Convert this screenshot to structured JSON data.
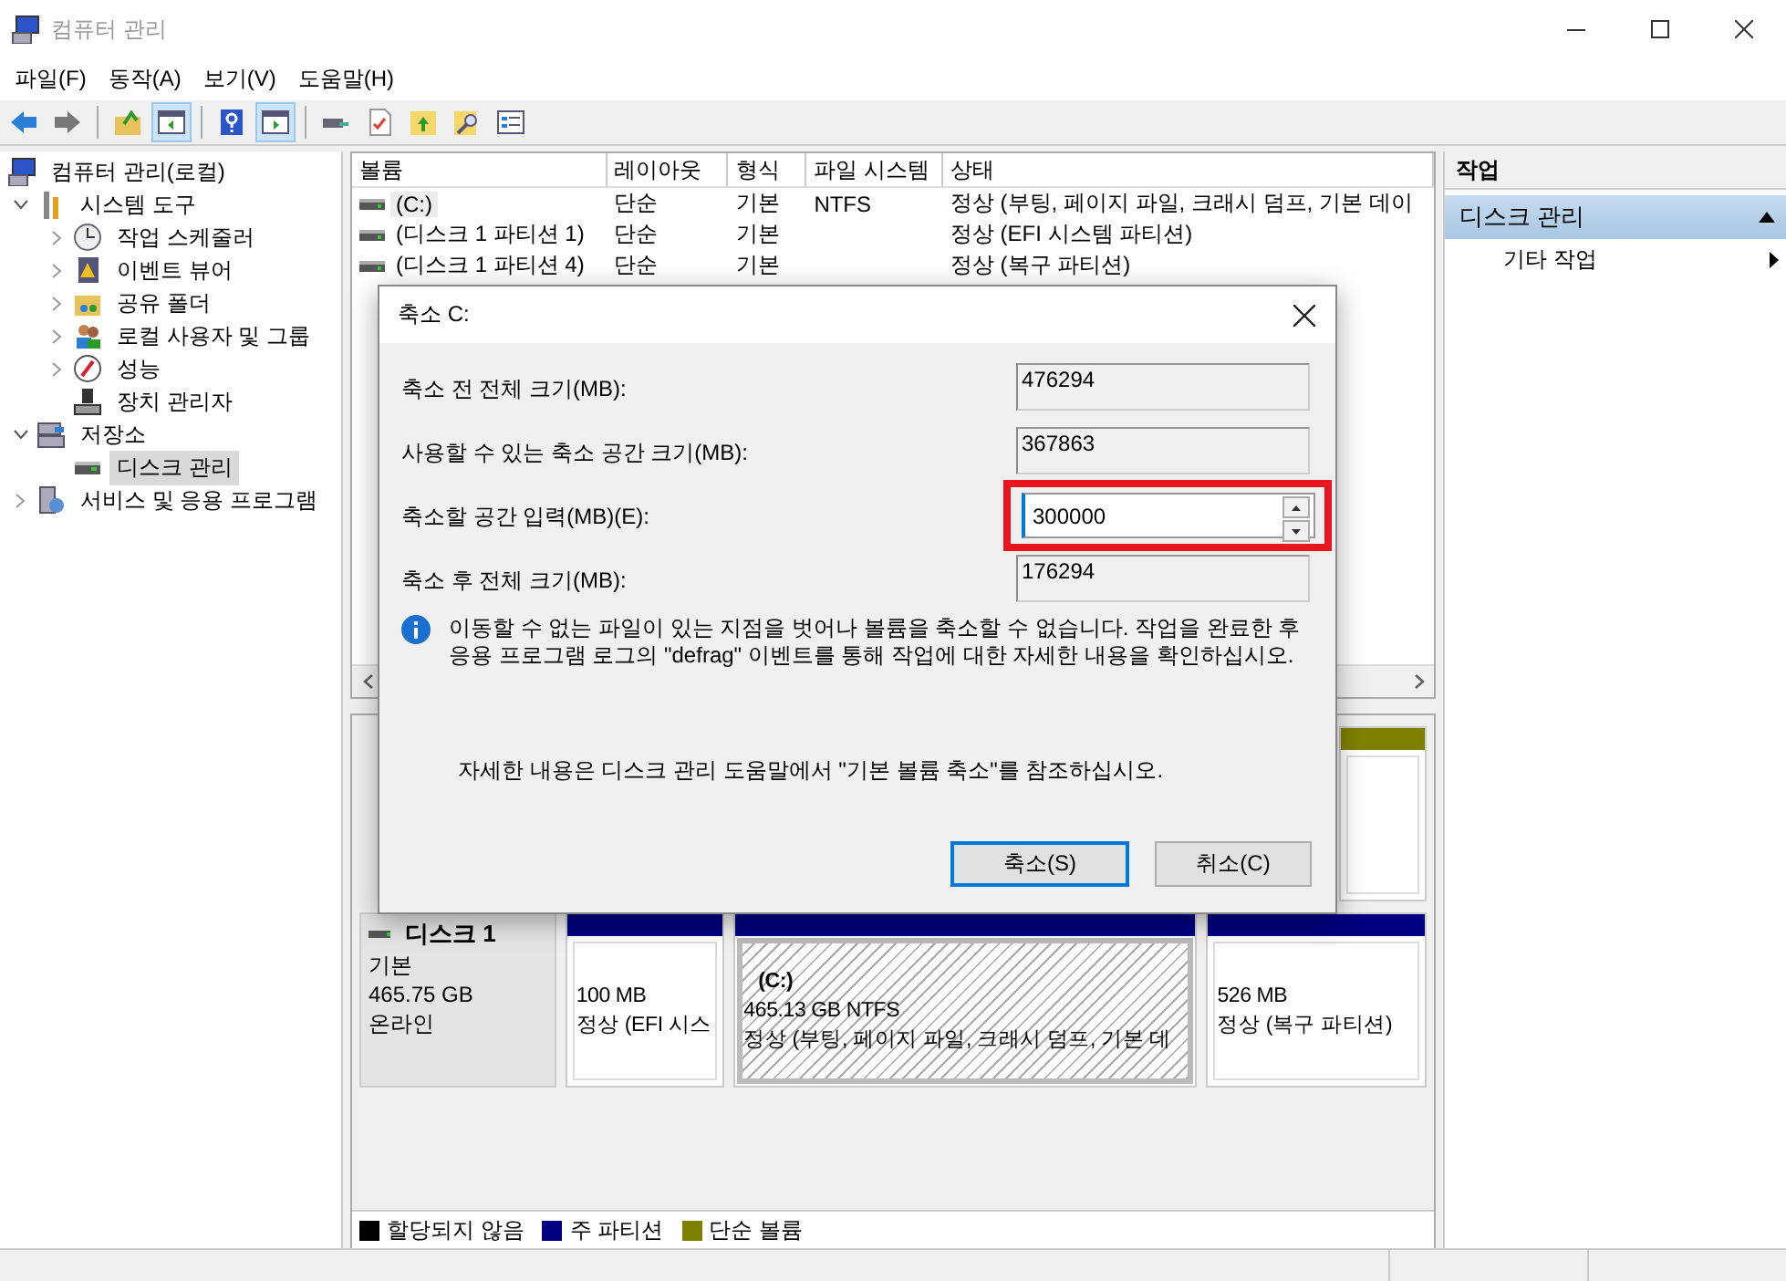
{
  "window": {
    "title": "컴퓨터 관리"
  },
  "menu": [
    "파일(F)",
    "동작(A)",
    "보기(V)",
    "도움말(H)"
  ],
  "toolbar": [
    {
      "kind": "button",
      "pressed": false
    },
    {
      "kind": "button",
      "pressed": false
    },
    {
      "kind": "separator"
    },
    {
      "kind": "button",
      "pressed": false
    },
    {
      "kind": "button",
      "pressed": true
    },
    {
      "kind": "separator"
    },
    {
      "kind": "button",
      "pressed": false
    },
    {
      "kind": "button",
      "pressed": true
    },
    {
      "kind": "separator"
    },
    {
      "kind": "button",
      "pressed": false
    },
    {
      "kind": "button",
      "pressed": false
    },
    {
      "kind": "button",
      "pressed": false
    },
    {
      "kind": "button",
      "pressed": false
    },
    {
      "kind": "button",
      "pressed": false
    }
  ],
  "tree": [
    {
      "label": "컴퓨터 관리(로컬)",
      "kind": "root",
      "selected": false,
      "children": [
        {
          "label": "시스템 도구",
          "kind": "node",
          "expanded": true,
          "selected": false,
          "children": [
            {
              "label": "작업 스케줄러",
              "kind": "node",
              "expanded": false,
              "selected": false
            },
            {
              "label": "이벤트 뷰어",
              "kind": "node",
              "expanded": false,
              "selected": false
            },
            {
              "label": "공유 폴더",
              "kind": "node",
              "expanded": false,
              "selected": false
            },
            {
              "label": "로컬 사용자 및 그룹",
              "kind": "node",
              "expanded": false,
              "selected": false
            },
            {
              "label": "성능",
              "kind": "node",
              "expanded": false,
              "selected": false
            },
            {
              "label": "장치 관리자",
              "kind": "leaf",
              "selected": false
            }
          ]
        },
        {
          "label": "저장소",
          "kind": "node",
          "expanded": true,
          "selected": false,
          "children": [
            {
              "label": "디스크 관리",
              "kind": "leaf",
              "selected": true
            }
          ]
        },
        {
          "label": "서비스 및 응용 프로그램",
          "kind": "node",
          "expanded": false,
          "selected": false
        }
      ]
    }
  ],
  "volume_list": {
    "columns": [
      "볼륨",
      "레이아웃",
      "형식",
      "파일 시스템",
      "상태"
    ],
    "rows": [
      {
        "volume": "(C:)",
        "layout": "단순",
        "type": "기본",
        "file_system": "NTFS",
        "status": "정상 (부팅, 페이지 파일, 크래시 덤프, 기본 데이",
        "selected": true
      },
      {
        "volume": "(디스크 1 파티션 1)",
        "layout": "단순",
        "type": "기본",
        "status": "정상 (EFI 시스템 파티션)",
        "selected": false
      },
      {
        "volume": "(디스크 1 파티션 4)",
        "layout": "단순",
        "type": "기본",
        "status": "정상 (복구 파티션)",
        "selected": false
      }
    ]
  },
  "disks": [
    {
      "partitions": [
        {
          "kind": "simple",
          "selected": false
        }
      ]
    },
    {
      "name": "디스크 1",
      "type": "기본",
      "size": "465.75 GB",
      "status": "온라인",
      "partitions": [
        {
          "kind": "primary",
          "selected": false,
          "size": "100 MB",
          "status": "정상 (EFI 시스"
        },
        {
          "kind": "primary",
          "selected": true,
          "name": "(C:)",
          "size": "465.13 GB NTFS",
          "status": "정상 (부팅, 페이지 파일, 크래시 덤프, 기본 데"
        },
        {
          "kind": "primary",
          "selected": false,
          "size": "526 MB",
          "status": "정상 (복구 파티션)"
        }
      ]
    }
  ],
  "legend": [
    {
      "label": "할당되지 않음",
      "color": "#000000"
    },
    {
      "label": "주 파티션",
      "color": "#000080"
    },
    {
      "label": "단순 볼륨",
      "color": "#808000"
    }
  ],
  "actions": {
    "title": "작업",
    "sections": [
      {
        "label": "디스크 관리",
        "expanded": true,
        "items": [
          "기타 작업"
        ]
      }
    ]
  },
  "dialog": {
    "title": "축소 C:",
    "fields": [
      {
        "label": "축소 전 전체 크기(MB):",
        "value": "476294",
        "kind": "readonly",
        "highlighted": false
      },
      {
        "label": "사용할 수 있는 축소 공간 크기(MB):",
        "value": "367863",
        "kind": "readonly",
        "highlighted": false
      },
      {
        "label": "축소할 공간 입력(MB)(E):",
        "value": "300000",
        "kind": "spin",
        "highlighted": true
      },
      {
        "label": "축소 후 전체 크기(MB):",
        "value": "176294",
        "kind": "readonly",
        "highlighted": false
      }
    ],
    "info": "이동할 수 없는 파일이 있는 지점을 벗어나 볼륨을 축소할 수 없습니다. 작업을 완료한 후 응용 프로그램 로그의 \"defrag\" 이벤트를 통해 작업에 대한 자세한 내용을 확인하십시오.",
    "help": "자세한 내용은 디스크 관리 도움말에서 \"기본 볼륨 축소\"를 참조하십시오.",
    "buttons": [
      {
        "label": "축소(S)",
        "default": true
      },
      {
        "label": "취소(C)",
        "default": false
      }
    ]
  }
}
